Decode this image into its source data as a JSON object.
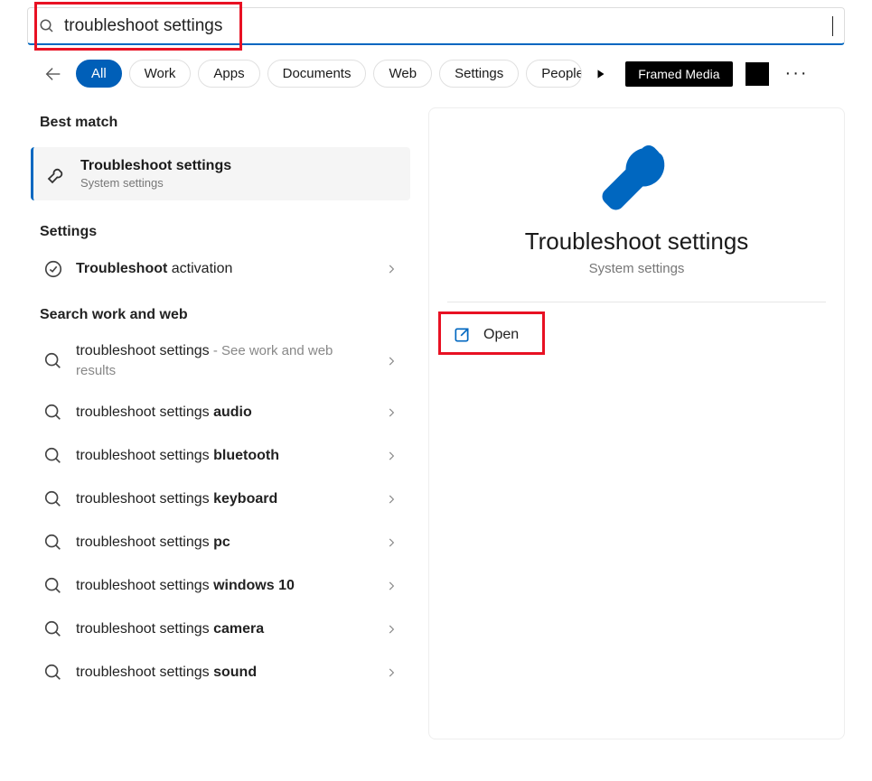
{
  "search": {
    "value": "troubleshoot settings"
  },
  "filters": {
    "all": "All",
    "work": "Work",
    "apps": "Apps",
    "documents": "Documents",
    "web": "Web",
    "settings": "Settings",
    "people": "People",
    "framed": "Framed Media"
  },
  "sections": {
    "best_match": "Best match",
    "settings": "Settings",
    "search_work_web": "Search work and web"
  },
  "best_match": {
    "title": "Troubleshoot settings",
    "subtitle": "System settings"
  },
  "settings_results": [
    {
      "prefix_bold": "Troubleshoot",
      "suffix": " activation"
    }
  ],
  "web_results": [
    {
      "prefix": "troubleshoot settings",
      "suffix": " - See work and web results",
      "suffix_muted": true
    },
    {
      "prefix": "troubleshoot settings ",
      "bold": "audio"
    },
    {
      "prefix": "troubleshoot settings ",
      "bold": "bluetooth"
    },
    {
      "prefix": "troubleshoot settings ",
      "bold": "keyboard"
    },
    {
      "prefix": "troubleshoot settings ",
      "bold": "pc"
    },
    {
      "prefix": "troubleshoot settings ",
      "bold": "windows 10"
    },
    {
      "prefix": "troubleshoot settings ",
      "bold": "camera"
    },
    {
      "prefix": "troubleshoot settings ",
      "bold": "sound"
    }
  ],
  "preview": {
    "title": "Troubleshoot settings",
    "subtitle": "System settings",
    "open_label": "Open"
  }
}
